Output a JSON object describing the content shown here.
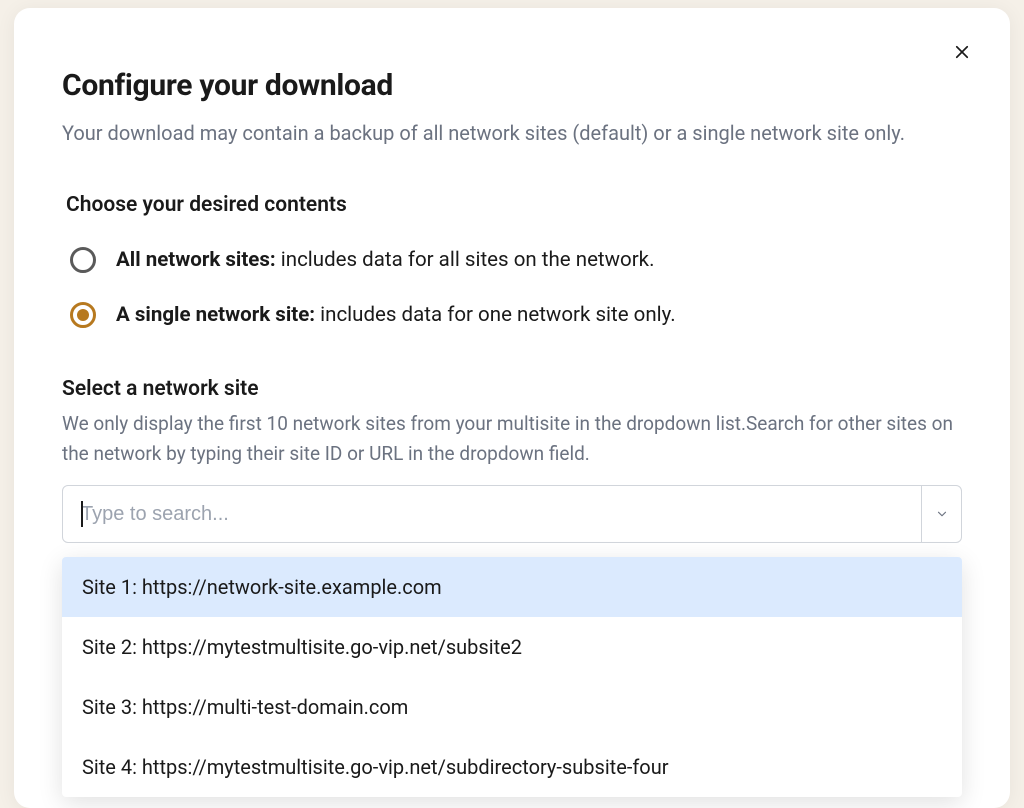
{
  "modal": {
    "title": "Configure your download",
    "subtitle": "Your download may contain a backup of all network sites (default) or a single network site only.",
    "section_label": "Choose your desired contents",
    "radios": [
      {
        "bold": "All network sites:",
        "rest": " includes data for all sites on the network.",
        "selected": false
      },
      {
        "bold": "A single network site:",
        "rest": " includes data for one network site only.",
        "selected": true
      }
    ],
    "select": {
      "label": "Select a network site",
      "help": "We only display the first 10 network sites from your multisite in the dropdown list.Search for other sites on the network by typing their site ID or URL in the dropdown field.",
      "placeholder": "Type to search..."
    },
    "dropdown_items": [
      "Site 1: https://network-site.example.com",
      "Site 2: https://mytestmultisite.go-vip.net/subsite2",
      "Site 3: https://multi-test-domain.com",
      "Site 4: https://mytestmultisite.go-vip.net/subdirectory-subsite-four"
    ]
  }
}
